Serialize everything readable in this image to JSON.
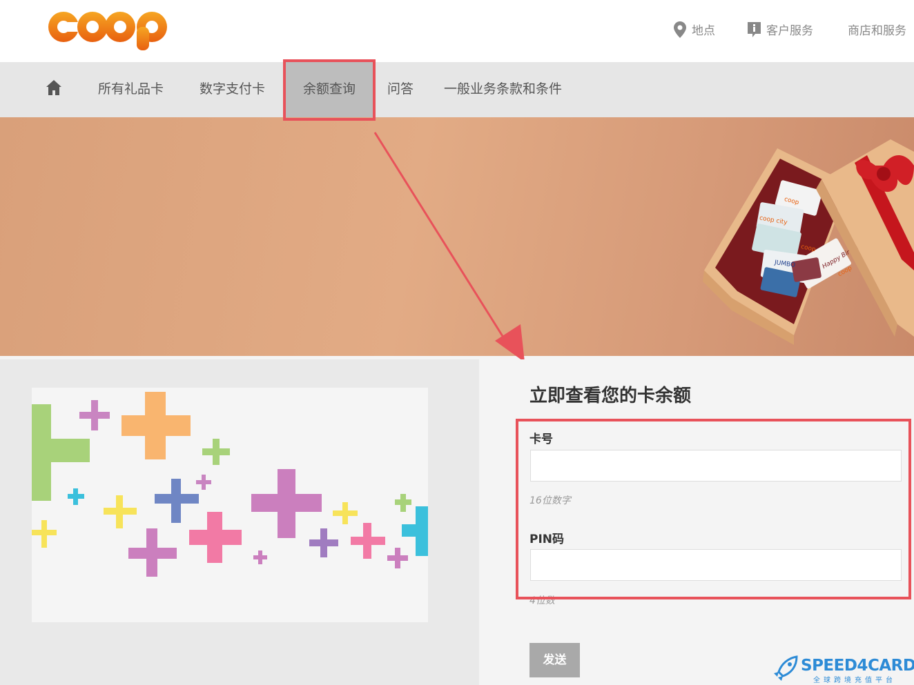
{
  "brand": {
    "logo_text": "coop"
  },
  "utility_nav": [
    {
      "label": "地点",
      "icon": "location-pin-icon"
    },
    {
      "label": "客户服务",
      "icon": "info-icon"
    },
    {
      "label": "商店和服务"
    }
  ],
  "main_nav": {
    "home_icon": "home-icon",
    "items": [
      {
        "label": "所有礼品卡"
      },
      {
        "label": "数字支付卡"
      },
      {
        "label": "余额查询",
        "active": true
      },
      {
        "label": "问答"
      },
      {
        "label": "一般业务条款和条件"
      }
    ]
  },
  "hero": {
    "image": "gift-box-with-gift-cards",
    "card_labels": [
      "coop",
      "coop city",
      "coop",
      "JUMBO",
      "Happy Birthday",
      "coop"
    ]
  },
  "balance_form": {
    "title": "立即查看您的卡余额",
    "card_number": {
      "label": "卡号",
      "value": "",
      "hint": "16位数字"
    },
    "pin": {
      "label": "PIN码",
      "value": "",
      "hint": "4位数"
    },
    "submit_label": "发送"
  },
  "watermark": {
    "text": "SPEED4CARD",
    "subtext": "全球跨境充值平台"
  },
  "colors": {
    "highlight": "#e8525a",
    "nav_bg": "#e6e6e6",
    "active_tab_bg": "#bdbdbd",
    "logo_orange": "#f07f1a",
    "watermark_blue": "#2d8bd6"
  }
}
